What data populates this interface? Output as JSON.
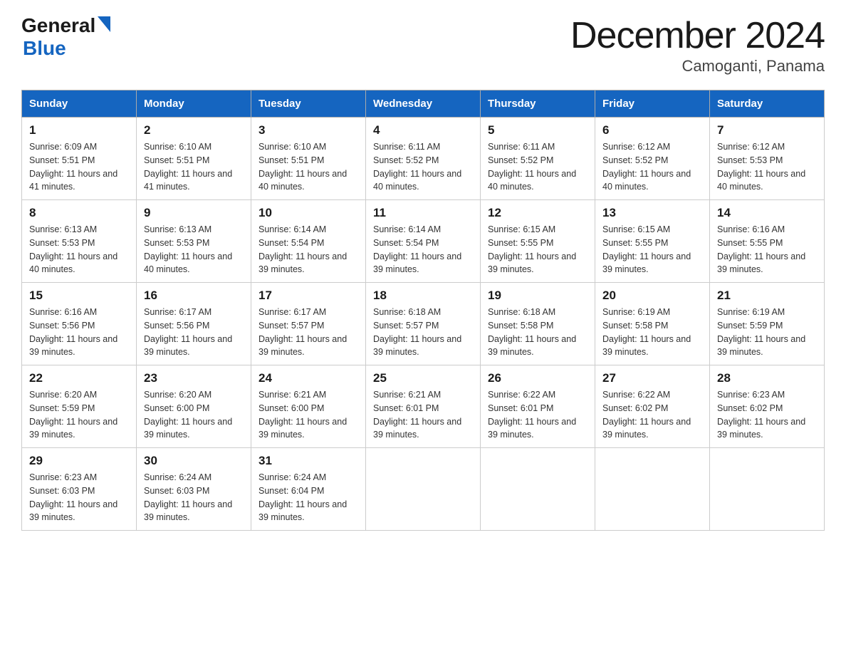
{
  "logo": {
    "general": "General",
    "blue": "Blue"
  },
  "title": "December 2024",
  "subtitle": "Camoganti, Panama",
  "days_of_week": [
    "Sunday",
    "Monday",
    "Tuesday",
    "Wednesday",
    "Thursday",
    "Friday",
    "Saturday"
  ],
  "weeks": [
    [
      {
        "day": "1",
        "sunrise": "6:09 AM",
        "sunset": "5:51 PM",
        "daylight": "11 hours and 41 minutes."
      },
      {
        "day": "2",
        "sunrise": "6:10 AM",
        "sunset": "5:51 PM",
        "daylight": "11 hours and 41 minutes."
      },
      {
        "day": "3",
        "sunrise": "6:10 AM",
        "sunset": "5:51 PM",
        "daylight": "11 hours and 40 minutes."
      },
      {
        "day": "4",
        "sunrise": "6:11 AM",
        "sunset": "5:52 PM",
        "daylight": "11 hours and 40 minutes."
      },
      {
        "day": "5",
        "sunrise": "6:11 AM",
        "sunset": "5:52 PM",
        "daylight": "11 hours and 40 minutes."
      },
      {
        "day": "6",
        "sunrise": "6:12 AM",
        "sunset": "5:52 PM",
        "daylight": "11 hours and 40 minutes."
      },
      {
        "day": "7",
        "sunrise": "6:12 AM",
        "sunset": "5:53 PM",
        "daylight": "11 hours and 40 minutes."
      }
    ],
    [
      {
        "day": "8",
        "sunrise": "6:13 AM",
        "sunset": "5:53 PM",
        "daylight": "11 hours and 40 minutes."
      },
      {
        "day": "9",
        "sunrise": "6:13 AM",
        "sunset": "5:53 PM",
        "daylight": "11 hours and 40 minutes."
      },
      {
        "day": "10",
        "sunrise": "6:14 AM",
        "sunset": "5:54 PM",
        "daylight": "11 hours and 39 minutes."
      },
      {
        "day": "11",
        "sunrise": "6:14 AM",
        "sunset": "5:54 PM",
        "daylight": "11 hours and 39 minutes."
      },
      {
        "day": "12",
        "sunrise": "6:15 AM",
        "sunset": "5:55 PM",
        "daylight": "11 hours and 39 minutes."
      },
      {
        "day": "13",
        "sunrise": "6:15 AM",
        "sunset": "5:55 PM",
        "daylight": "11 hours and 39 minutes."
      },
      {
        "day": "14",
        "sunrise": "6:16 AM",
        "sunset": "5:55 PM",
        "daylight": "11 hours and 39 minutes."
      }
    ],
    [
      {
        "day": "15",
        "sunrise": "6:16 AM",
        "sunset": "5:56 PM",
        "daylight": "11 hours and 39 minutes."
      },
      {
        "day": "16",
        "sunrise": "6:17 AM",
        "sunset": "5:56 PM",
        "daylight": "11 hours and 39 minutes."
      },
      {
        "day": "17",
        "sunrise": "6:17 AM",
        "sunset": "5:57 PM",
        "daylight": "11 hours and 39 minutes."
      },
      {
        "day": "18",
        "sunrise": "6:18 AM",
        "sunset": "5:57 PM",
        "daylight": "11 hours and 39 minutes."
      },
      {
        "day": "19",
        "sunrise": "6:18 AM",
        "sunset": "5:58 PM",
        "daylight": "11 hours and 39 minutes."
      },
      {
        "day": "20",
        "sunrise": "6:19 AM",
        "sunset": "5:58 PM",
        "daylight": "11 hours and 39 minutes."
      },
      {
        "day": "21",
        "sunrise": "6:19 AM",
        "sunset": "5:59 PM",
        "daylight": "11 hours and 39 minutes."
      }
    ],
    [
      {
        "day": "22",
        "sunrise": "6:20 AM",
        "sunset": "5:59 PM",
        "daylight": "11 hours and 39 minutes."
      },
      {
        "day": "23",
        "sunrise": "6:20 AM",
        "sunset": "6:00 PM",
        "daylight": "11 hours and 39 minutes."
      },
      {
        "day": "24",
        "sunrise": "6:21 AM",
        "sunset": "6:00 PM",
        "daylight": "11 hours and 39 minutes."
      },
      {
        "day": "25",
        "sunrise": "6:21 AM",
        "sunset": "6:01 PM",
        "daylight": "11 hours and 39 minutes."
      },
      {
        "day": "26",
        "sunrise": "6:22 AM",
        "sunset": "6:01 PM",
        "daylight": "11 hours and 39 minutes."
      },
      {
        "day": "27",
        "sunrise": "6:22 AM",
        "sunset": "6:02 PM",
        "daylight": "11 hours and 39 minutes."
      },
      {
        "day": "28",
        "sunrise": "6:23 AM",
        "sunset": "6:02 PM",
        "daylight": "11 hours and 39 minutes."
      }
    ],
    [
      {
        "day": "29",
        "sunrise": "6:23 AM",
        "sunset": "6:03 PM",
        "daylight": "11 hours and 39 minutes."
      },
      {
        "day": "30",
        "sunrise": "6:24 AM",
        "sunset": "6:03 PM",
        "daylight": "11 hours and 39 minutes."
      },
      {
        "day": "31",
        "sunrise": "6:24 AM",
        "sunset": "6:04 PM",
        "daylight": "11 hours and 39 minutes."
      },
      null,
      null,
      null,
      null
    ]
  ]
}
